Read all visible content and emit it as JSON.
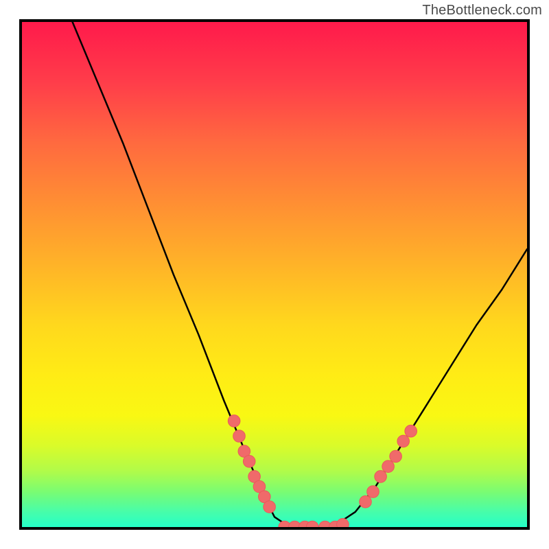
{
  "attribution": "TheBottleneck.com",
  "colors": {
    "frame_border": "#000000",
    "curve_stroke": "#000000",
    "dot_fill": "#f06a6a",
    "dot_stroke": "#ea5a5a",
    "gradient_top": "#ff1a4b",
    "gradient_bottom": "#25ffc8"
  },
  "chart_data": {
    "type": "line",
    "title": "",
    "xlabel": "",
    "ylabel": "",
    "xlim": [
      0,
      100
    ],
    "ylim": [
      0,
      100
    ],
    "grid": false,
    "legend": false,
    "description": "A single V-shaped curve over a vertical red→green gradient. Y axis reads as a percentage-style quantity (100 at top, 0 at bottom). The curve enters at top-left around x≈10, descends near-linearly, flattens at y≈0 over roughly x≈50–65, then rises again to about y≈55 at x=100. Salmon-colored dots highlight the curve around the trough and the start of the rising arm. Values estimated from position.",
    "series": [
      {
        "name": "curve",
        "points": [
          {
            "x": 10,
            "y": 100
          },
          {
            "x": 15,
            "y": 88
          },
          {
            "x": 20,
            "y": 76
          },
          {
            "x": 25,
            "y": 63
          },
          {
            "x": 30,
            "y": 50
          },
          {
            "x": 35,
            "y": 38
          },
          {
            "x": 40,
            "y": 25
          },
          {
            "x": 45,
            "y": 13
          },
          {
            "x": 48,
            "y": 6
          },
          {
            "x": 50,
            "y": 2
          },
          {
            "x": 53,
            "y": 0
          },
          {
            "x": 56,
            "y": 0
          },
          {
            "x": 60,
            "y": 0
          },
          {
            "x": 63,
            "y": 1
          },
          {
            "x": 66,
            "y": 3
          },
          {
            "x": 70,
            "y": 8
          },
          {
            "x": 75,
            "y": 16
          },
          {
            "x": 80,
            "y": 24
          },
          {
            "x": 85,
            "y": 32
          },
          {
            "x": 90,
            "y": 40
          },
          {
            "x": 95,
            "y": 47
          },
          {
            "x": 100,
            "y": 55
          }
        ]
      }
    ],
    "highlight_dots_left": [
      {
        "x": 42,
        "y": 21
      },
      {
        "x": 43,
        "y": 18
      },
      {
        "x": 44,
        "y": 15
      },
      {
        "x": 45,
        "y": 13
      },
      {
        "x": 46,
        "y": 10
      },
      {
        "x": 47,
        "y": 8
      },
      {
        "x": 48,
        "y": 6
      },
      {
        "x": 49,
        "y": 4
      }
    ],
    "highlight_dots_floor": [
      {
        "x": 52,
        "y": 0
      },
      {
        "x": 54,
        "y": 0
      },
      {
        "x": 56,
        "y": 0
      },
      {
        "x": 57.5,
        "y": 0
      },
      {
        "x": 60,
        "y": 0
      },
      {
        "x": 62,
        "y": 0
      },
      {
        "x": 63.5,
        "y": 0.5
      }
    ],
    "highlight_dots_right": [
      {
        "x": 68,
        "y": 5
      },
      {
        "x": 69.5,
        "y": 7
      },
      {
        "x": 71,
        "y": 10
      },
      {
        "x": 72.5,
        "y": 12
      },
      {
        "x": 74,
        "y": 14
      },
      {
        "x": 75.5,
        "y": 17
      },
      {
        "x": 77,
        "y": 19
      }
    ],
    "dot_radius_data_units": 1.2
  }
}
